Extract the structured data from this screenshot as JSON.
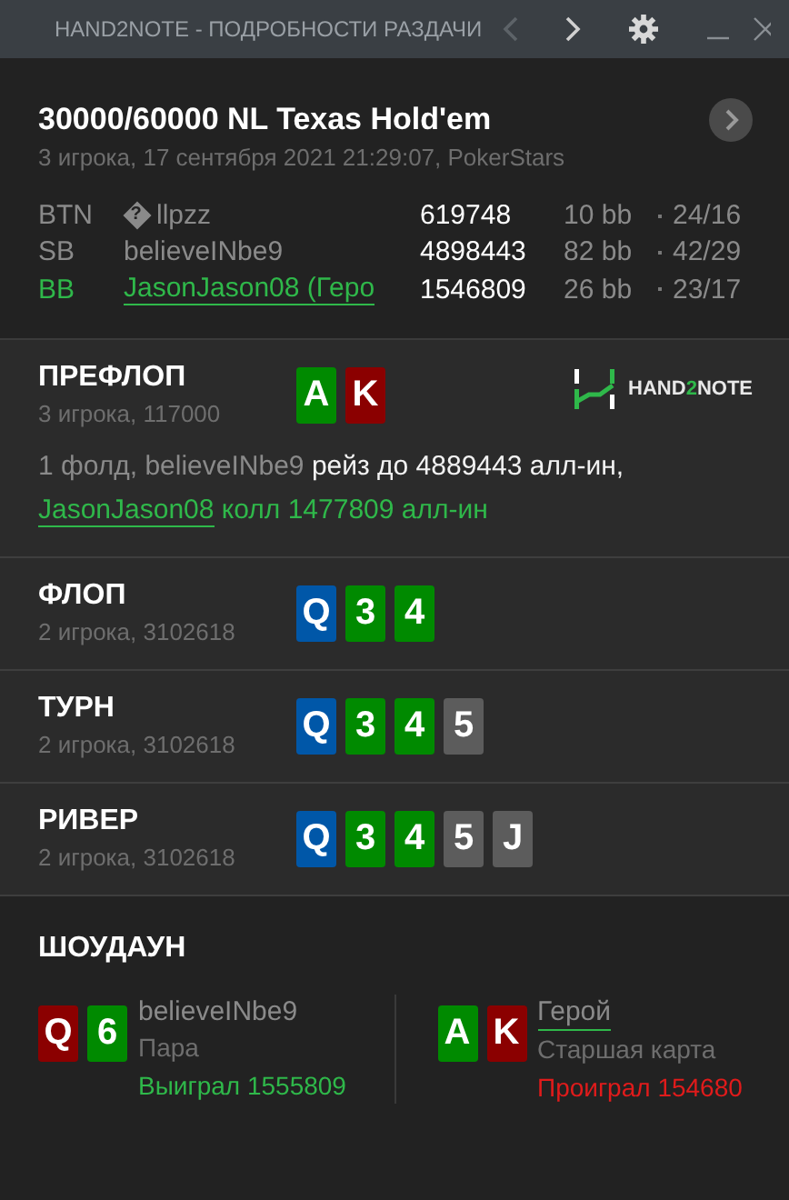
{
  "window": {
    "title": "HAND2NOTE - ПОДРОБНОСТИ РАЗДАЧИ",
    "prev_disabled": true,
    "next_disabled": false
  },
  "hand": {
    "title": "30000/60000 NL Texas Hold'em",
    "subtitle": "3 игрока, 17 сентября 2021 21:29:07, PokerStars",
    "players": [
      {
        "position": "BTN",
        "name_mark": "?",
        "name": "llpzz",
        "stack": "619748",
        "bb": "10 bb",
        "stats": "24/16",
        "hero": false
      },
      {
        "position": "SB",
        "name": "believeINbe9",
        "stack": "4898443",
        "bb": "82 bb",
        "stats": "42/29",
        "hero": false
      },
      {
        "position": "BB",
        "name": "JasonJason08 (Геро",
        "stack": "1546809",
        "bb": "26 bb",
        "stats": "23/17",
        "hero": true
      }
    ]
  },
  "logo": {
    "parts": [
      {
        "text": "HAND",
        "accent": false
      },
      {
        "text": "2",
        "accent": true
      },
      {
        "text": "NOTE",
        "accent": false
      }
    ]
  },
  "streets": [
    {
      "title": "ПРЕФЛОП",
      "subtitle": "3 игрока, 117000",
      "cards": [
        {
          "rank": "A",
          "color": "#008a00"
        },
        {
          "rank": "K",
          "color": "#8b0000"
        }
      ],
      "actions": [
        {
          "parts": [
            {
              "kind": "muted",
              "text": "1 фолд, believeINbe9"
            },
            {
              "kind": "strong",
              "text": "рейз до 4889443 алл-ин,"
            }
          ]
        },
        {
          "parts": [
            {
              "kind": "hero-link",
              "text": "JasonJason08"
            },
            {
              "kind": "hero",
              "text": "колл 1477809 алл-ин"
            }
          ]
        }
      ]
    },
    {
      "title": "ФЛОП",
      "subtitle": "2 игрока, 3102618",
      "cards": [
        {
          "rank": "Q",
          "color": "#0057a8"
        },
        {
          "rank": "3",
          "color": "#008a00"
        },
        {
          "rank": "4",
          "color": "#008a00"
        }
      ]
    },
    {
      "title": "ТУРН",
      "subtitle": "2 игрока, 3102618",
      "cards": [
        {
          "rank": "Q",
          "color": "#0057a8"
        },
        {
          "rank": "3",
          "color": "#008a00"
        },
        {
          "rank": "4",
          "color": "#008a00"
        },
        {
          "rank": "5",
          "color": "#5c5c5c"
        }
      ]
    },
    {
      "title": "РИВЕР",
      "subtitle": "2 игрока, 3102618",
      "cards": [
        {
          "rank": "Q",
          "color": "#0057a8"
        },
        {
          "rank": "3",
          "color": "#008a00"
        },
        {
          "rank": "4",
          "color": "#008a00"
        },
        {
          "rank": "5",
          "color": "#5c5c5c"
        },
        {
          "rank": "J",
          "color": "#5c5c5c"
        }
      ]
    }
  ],
  "showdown": {
    "title": "ШОУДАУН",
    "hands": [
      {
        "cards": [
          {
            "rank": "Q",
            "color": "#8b0000"
          },
          {
            "rank": "6",
            "color": "#008a00"
          }
        ],
        "name": "believeINbe9",
        "hero": false,
        "combination": "Пара",
        "result": "Выиграл 1555809",
        "won": true
      },
      {
        "cards": [
          {
            "rank": "A",
            "color": "#008a00"
          },
          {
            "rank": "K",
            "color": "#8b0000"
          }
        ],
        "name": "Герой",
        "hero": true,
        "combination": "Старшая карта",
        "result": "Проиграл 154680",
        "won": false
      }
    ]
  }
}
